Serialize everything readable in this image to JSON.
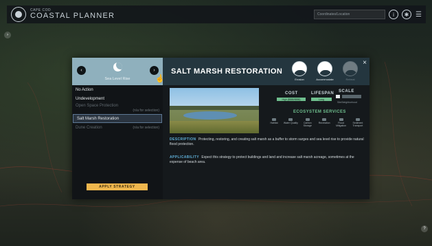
{
  "header": {
    "logo_small": "CAPE COD",
    "logo_big": "COASTAL PLANNER",
    "search_placeholder": "Coordinates/Location",
    "icons": [
      "info-icon",
      "settings-icon",
      "menu-icon"
    ]
  },
  "side_arrow": "›",
  "help_btn": "?",
  "modal": {
    "slr": {
      "label": "Sea Level Rise",
      "prev": "‹",
      "next": "›"
    },
    "options": [
      {
        "label": "No Action",
        "na": "",
        "state": "normal"
      },
      {
        "label": "Undevelopment",
        "na": "",
        "state": "normal"
      },
      {
        "label": "Open Space Protection",
        "na": "(n/a for selection)",
        "state": "disabled"
      },
      {
        "label": "Salt Marsh Restoration",
        "na": "",
        "state": "selected"
      },
      {
        "label": "Dune Creation",
        "na": "(n/a for selection)",
        "state": "disabled"
      }
    ],
    "apply_label": "APPLY STRATEGY",
    "title": "SALT MARSH RESTORATION",
    "hazards": [
      {
        "label": "Erosion",
        "active": true
      },
      {
        "label": "Accommodate",
        "active": true
      },
      {
        "label": "Retreat",
        "active": false
      }
    ],
    "close": "×",
    "stats": {
      "cost_label": "COST",
      "cost_value": "High ($$$$/$$$$)",
      "lifespan_label": "LIFESPAN",
      "lifespan_value": "Long",
      "scale_label": "SCALE",
      "scale_sub": "Site/Neighborhood"
    },
    "eco_label": "ECOSYSTEM SERVICES",
    "eco_items": [
      "Habitat",
      "Water Quality",
      "Carbon Storage",
      "Recreation",
      "Flood Mitigation",
      "Sediment Transport"
    ],
    "description_key": "DESCRIPTION",
    "description_text": "Protecting, restoring, and creating salt marsh as a buffer to storm surges and sea level rise to provide natural flood protection.",
    "applicability_key": "APPLICABILITY",
    "applicability_text": "Expect this strategy to protect buildings and land and increase salt marsh acreage, sometimes at the expense of beach area."
  },
  "colors": {
    "accent": "#8fb0bd",
    "apply": "#efb64d",
    "green": "#6fbf8e",
    "blue_key": "#5fb0d9"
  }
}
